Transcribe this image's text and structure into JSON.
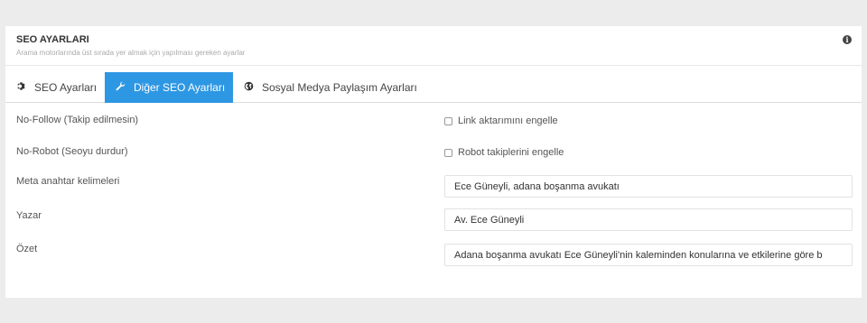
{
  "panel": {
    "title": "SEO AYARLARI",
    "subtitle": "Arama motorlarında üst sırada yer almak için yapılması gereken ayarlar"
  },
  "tabs": [
    {
      "label": "SEO Ayarları",
      "icon": "gear-icon",
      "active": false
    },
    {
      "label": "Diğer SEO Ayarları",
      "icon": "wrench-icon",
      "active": true
    },
    {
      "label": "Sosyal Medya Paylaşım Ayarları",
      "icon": "globe-icon",
      "active": false
    }
  ],
  "form": {
    "nofollow_label": "No-Follow (Takip edilmesin)",
    "nofollow_checkbox": "Link aktarımını engelle",
    "norobot_label": "No-Robot (Seoyu durdur)",
    "norobot_checkbox": "Robot takiplerini engelle",
    "meta_label": "Meta anahtar kelimeleri",
    "meta_value": "Ece Güneyli, adana boşanma avukatı",
    "author_label": "Yazar",
    "author_value": "Av. Ece Güneyli",
    "summary_label": "Özet",
    "summary_value": "Adana boşanma avukatı Ece Güneyli'nin kaleminden konularına ve etkilerine göre b"
  },
  "colors": {
    "accent": "#2d97e3",
    "background": "#ececec"
  }
}
